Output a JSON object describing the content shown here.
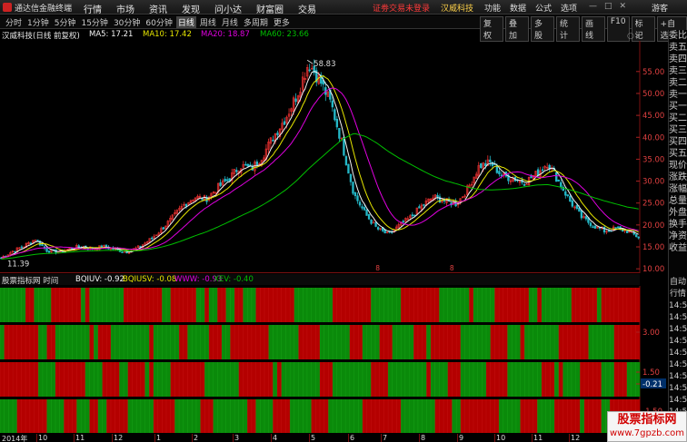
{
  "titlebar": {
    "app_name": "通达信金融终端",
    "menu": [
      "行情",
      "市场",
      "资讯",
      "发现",
      "问小达",
      "财富圈",
      "交易"
    ],
    "status": "证劵交易未登录",
    "stock_name": "汉威科技",
    "right_menu": [
      "功能",
      "数据",
      "公式",
      "选项"
    ],
    "guest": "游客"
  },
  "period_bar": {
    "periods": [
      "分时",
      "1分钟",
      "5分钟",
      "15分钟",
      "30分钟",
      "60分钟",
      "日线",
      "周线",
      "月线",
      "多周期",
      "更多"
    ],
    "active": "日线",
    "tools": [
      "复权",
      "叠加",
      "多股",
      "统计",
      "画线",
      "F10",
      "标记",
      "+自选"
    ]
  },
  "chart_info": {
    "title": "汉威科技(日线 前复权)",
    "ma5": "MA5: 17.21",
    "ma10": "MA10: 17.42",
    "ma20": "MA20: 18.87",
    "ma60": "MA60: 23.66"
  },
  "price_axis": [
    "55.00",
    "50.00",
    "45.00",
    "40.00",
    "35.00",
    "30.00",
    "25.00",
    "20.00",
    "15.00",
    "10.00"
  ],
  "annotations": {
    "high": "58.83",
    "low": "11.39",
    "marker": "8"
  },
  "indicator": {
    "name": "股票指标网 时间",
    "bqiuv": "BQIUV: -0.92",
    "bqiusv": "BQIUSV: -0.08",
    "www": "WWW: -0.93",
    "xev": "XEV: -0.40",
    "axis": [
      "3.00",
      "1.50",
      "-0.21",
      "-1.50"
    ]
  },
  "date_axis": [
    "2014年",
    "10",
    "11",
    "12",
    "1",
    "2",
    "3",
    "4",
    "5",
    "6",
    "7",
    "8",
    "9",
    "10",
    "11",
    "12",
    "1",
    "2"
  ],
  "side_panel": [
    "委比",
    "卖五",
    "卖四",
    "卖三",
    "卖二",
    "卖一",
    "买一",
    "买二",
    "买三",
    "买四",
    "买五",
    "现价",
    "涨跌",
    "涨幅",
    "总量",
    "外盘",
    "换手",
    "净资",
    "收益"
  ],
  "side_panel_2": [
    "自动",
    "行情",
    "14:56",
    "14:56",
    "14:56",
    "14:56",
    "14:56",
    "14:56",
    "14:56",
    "14:56",
    "14:56",
    "14:56"
  ],
  "watermark": {
    "line1": "股票指标网",
    "line2": "www.7gpzb.com"
  },
  "colors": {
    "up": "#e83030",
    "down": "#24b8c8",
    "ma5": "#f4f4f4",
    "ma10": "#e6e600",
    "ma20": "#e000e0",
    "ma60": "#00c000",
    "bar_red": "#b40000",
    "bar_green": "#0a8a0a"
  },
  "chart_data": {
    "type": "candlestick",
    "title": "汉威科技(日线 前复权)",
    "ylim": [
      9,
      62
    ],
    "close_trend": [
      12.5,
      14,
      15.2,
      16.8,
      14.2,
      13.8,
      14.6,
      15.1,
      14.7,
      15,
      14.4,
      13.9,
      14.8,
      16.5,
      18.8,
      21.5,
      24.5,
      26.4,
      25.9,
      28.5,
      30.5,
      33.6,
      32.8,
      36,
      40.5,
      44.5,
      49.8,
      57,
      53,
      47.5,
      38,
      27,
      22.5,
      19.2,
      17.8,
      19.9,
      21.8,
      24.5,
      26.4,
      25.4,
      24.8,
      28.3,
      33.5,
      34.2,
      31.2,
      30.6,
      29.8,
      31.6,
      34.2,
      29.8,
      25.3,
      21.7,
      19.9,
      18.6,
      19.2,
      18.6,
      17.2
    ],
    "ma60_trend": [
      12.2,
      12.5,
      12.9,
      13.3,
      13.5,
      13.6,
      13.8,
      14,
      14.1,
      14.2,
      14.2,
      14.1,
      14.1,
      14.4,
      14.9,
      15.6,
      16.5,
      17.5,
      18.4,
      19.5,
      20.7,
      22,
      23.2,
      24.6,
      26.2,
      28,
      30.2,
      32.8,
      35.1,
      37.4,
      39.6,
      40.9,
      40.2,
      38.7,
      36.8,
      35.2,
      33.8,
      32.4,
      31.1,
      30.1,
      29.4,
      28.6,
      28.1,
      28,
      28.1,
      28.3,
      28.7,
      29.1,
      29.2,
      28.7,
      28,
      27.2,
      26.3,
      25.5,
      24.8,
      24.1,
      23.66
    ]
  }
}
